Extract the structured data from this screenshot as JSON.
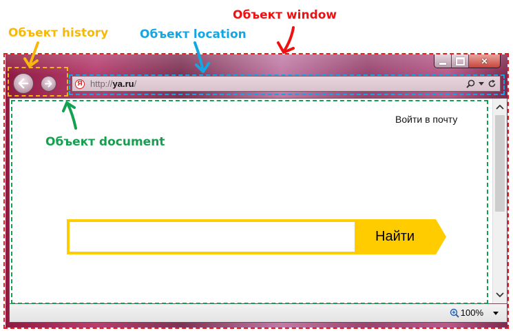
{
  "annotations": {
    "window": "Объект window",
    "history": "Объект history",
    "location": "Объект location",
    "document": "Объект document"
  },
  "browser": {
    "favicon_letter": "Я",
    "url_scheme": "http://",
    "url_host": "ya.ru",
    "url_path": "/",
    "zoom": "100%"
  },
  "page": {
    "login_link": "Войти в почту",
    "search_button": "Найти",
    "search_query": ""
  },
  "colors": {
    "window_annotation": "#e21c1c",
    "history_annotation": "#f6b80a",
    "location_annotation": "#13a6e4",
    "document_annotation": "#13a04f",
    "yandex_yellow": "#ffcc00"
  },
  "icons": [
    "back-arrow-icon",
    "forward-arrow-icon",
    "yandex-favicon-icon",
    "search-icon",
    "dropdown-icon",
    "refresh-icon",
    "minimize-icon",
    "maximize-icon",
    "close-icon",
    "scroll-up-icon",
    "scroll-down-icon",
    "zoom-icon"
  ]
}
